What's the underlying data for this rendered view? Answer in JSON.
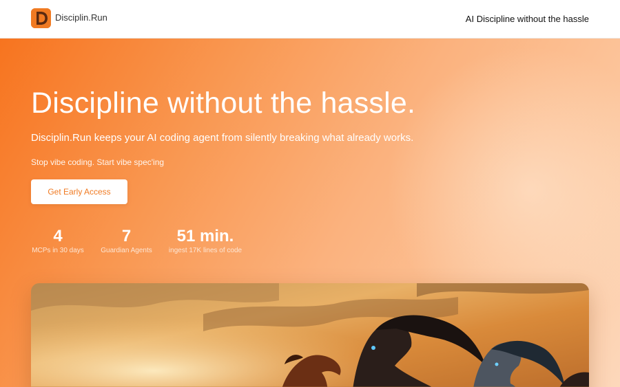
{
  "nav": {
    "logo_icon": "letter-d-logo-icon",
    "brand": "Disciplin.Run",
    "tagline": "AI Discipline without the hassle"
  },
  "hero": {
    "headline": "Discipline without the hassle.",
    "subheadline": "Disciplin.Run keeps your AI coding agent from silently breaking what already works.",
    "motto": "Stop vibe coding. Start vibe spec'ing",
    "cta_label": "Get Early Access",
    "stats": [
      {
        "value": "4",
        "label": "MCPs in 30 days"
      },
      {
        "value": "7",
        "label": "Guardian Agents"
      },
      {
        "value": "51 min.",
        "label": "ingest 17K lines of code"
      }
    ]
  },
  "colors": {
    "accent": "#f07a22",
    "hero_gradient_start": "#f7741f",
    "hero_gradient_end": "#fdd8bb"
  }
}
